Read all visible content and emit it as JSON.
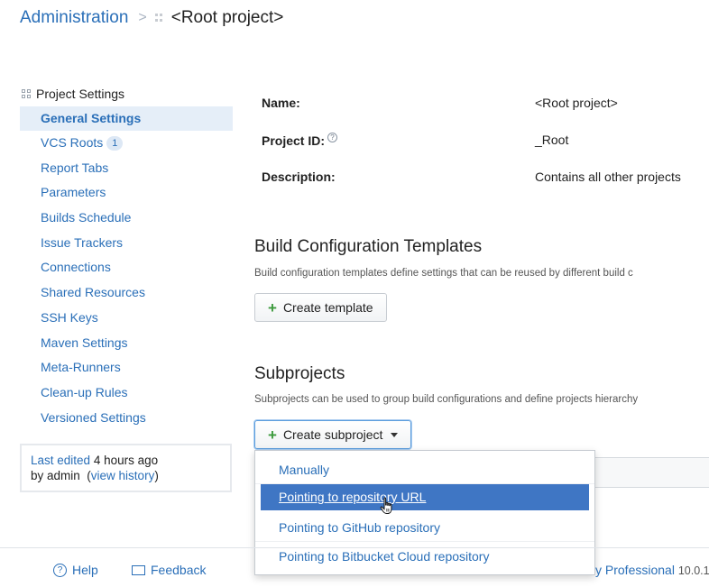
{
  "breadcrumb": {
    "admin_label": "Administration",
    "separator": ">",
    "current": "<Root project>"
  },
  "sidebar": {
    "header": "Project Settings",
    "items": [
      {
        "label": "General Settings",
        "active": true
      },
      {
        "label": "VCS Roots",
        "badge": "1"
      },
      {
        "label": "Report Tabs"
      },
      {
        "label": "Parameters"
      },
      {
        "label": "Builds Schedule"
      },
      {
        "label": "Issue Trackers"
      },
      {
        "label": "Connections"
      },
      {
        "label": "Shared Resources"
      },
      {
        "label": "SSH Keys"
      },
      {
        "label": "Maven Settings"
      },
      {
        "label": "Meta-Runners"
      },
      {
        "label": "Clean-up Rules"
      },
      {
        "label": "Versioned Settings"
      }
    ]
  },
  "last_edit": {
    "prefix": "Last edited",
    "time": "4 hours ago",
    "by": "by admin",
    "open_paren": "(",
    "history_link": "view history",
    "close_paren": ")"
  },
  "project": {
    "name_label": "Name:",
    "name_value": "<Root project>",
    "id_label": "Project ID:",
    "id_help": "?",
    "id_value": "_Root",
    "desc_label": "Description:",
    "desc_value": "Contains all other projects"
  },
  "templates": {
    "title": "Build Configuration Templates",
    "description": "Build configuration templates define settings that can be reused by different build c",
    "create_button": "Create template"
  },
  "subprojects": {
    "title": "Subprojects",
    "description": "Subprojects can be used to group build configurations and define projects hierarchy",
    "create_button": "Create subproject"
  },
  "dropdown": {
    "items": [
      "Manually",
      "Pointing to repository URL",
      "Pointing to GitHub repository",
      "Pointing to Bitbucket Cloud repository"
    ],
    "highlighted_index": 1
  },
  "footer": {
    "help": "Help",
    "feedback": "Feedback",
    "edition_partial": "y Professional",
    "version_partial": "10.0.1"
  },
  "colors": {
    "link": "#2a6fb8",
    "highlight": "#3f76c4",
    "active_bg": "#e5eef8",
    "plus": "#3c9a3c"
  }
}
